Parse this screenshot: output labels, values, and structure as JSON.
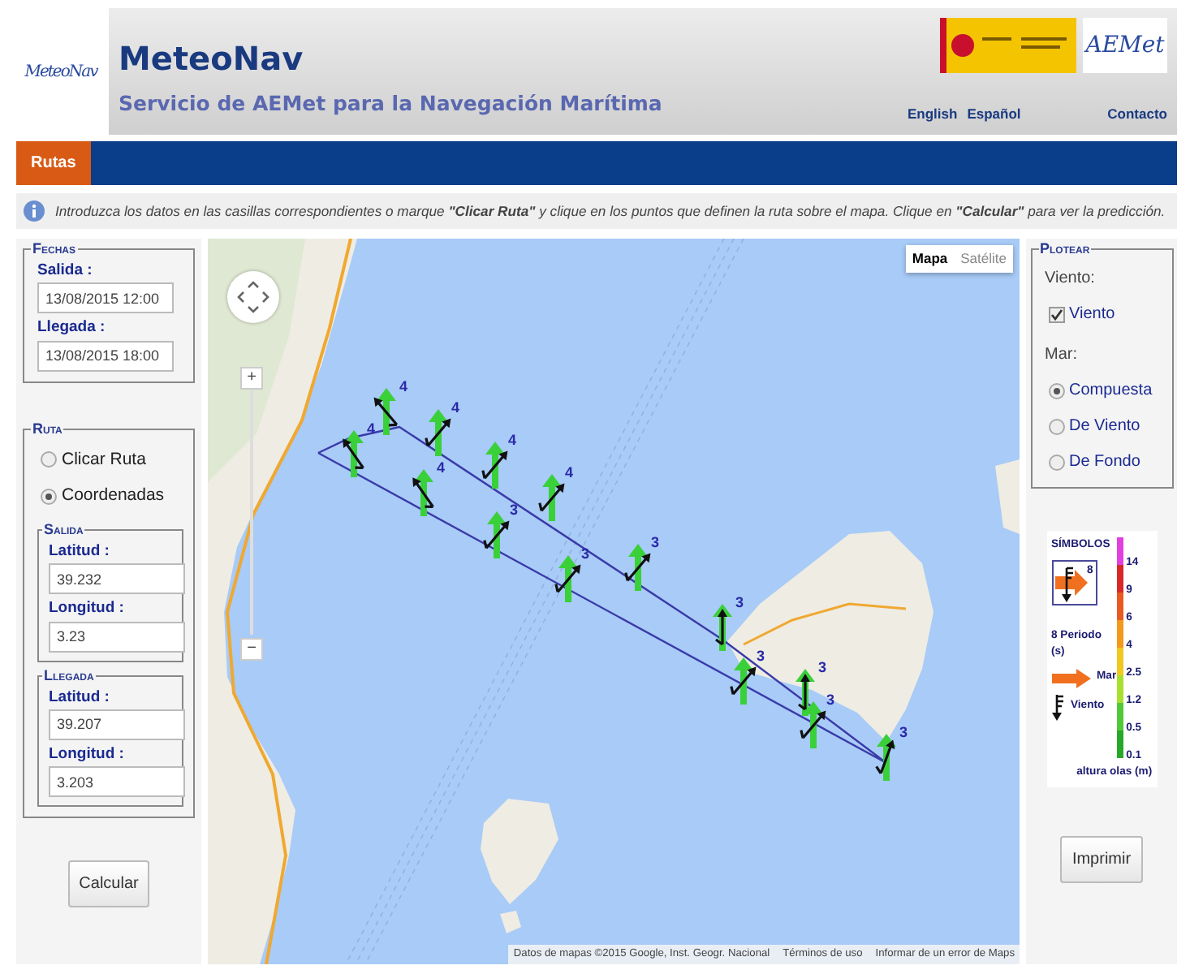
{
  "header": {
    "logo": "MeteoNav",
    "title": "MeteoNav",
    "subtitle": "Servicio de AEMet para la Navegación Marítima",
    "partner_logo": "AEMet",
    "links": [
      "English",
      "Español"
    ],
    "contact": "Contacto"
  },
  "tabs": [
    {
      "label": "Rutas",
      "selected": true
    }
  ],
  "info": "Introduzca los datos en las casillas correspondientes o marque **\"Clicar Ruta\"** y clique en los puntos que definen la ruta sobre el mapa. Clique en **\"Calcular\"** para ver la predicción.",
  "fechas": {
    "legend": "Fechas",
    "fields": [
      {
        "label": "Salida :",
        "value": "13/08/2015 12:00"
      },
      {
        "label": "Llegada :",
        "value": "13/08/2015 18:00"
      }
    ]
  },
  "ruta": {
    "legend": "Ruta",
    "options": [
      {
        "label": "Clicar Ruta",
        "selected": false
      },
      {
        "label": "Coordenadas",
        "selected": true
      }
    ],
    "groups": [
      {
        "legend": "Salida",
        "fields": [
          {
            "label": "Latitud :",
            "value": "39.232"
          },
          {
            "label": "Longitud :",
            "value": "3.23"
          }
        ]
      },
      {
        "legend": "Llegada",
        "fields": [
          {
            "label": "Latitud :",
            "value": "39.207"
          },
          {
            "label": "Longitud :",
            "value": "3.203"
          }
        ]
      }
    ]
  },
  "calcular_button": "Calcular",
  "map": {
    "type_buttons": [
      {
        "label": "Mapa",
        "selected": true
      },
      {
        "label": "Satélite",
        "selected": false
      }
    ],
    "zoom_in": "+",
    "zoom_out": "−",
    "markers": [
      {
        "label": "4"
      },
      {
        "label": "4"
      },
      {
        "label": "4"
      },
      {
        "label": "4"
      },
      {
        "label": "4"
      },
      {
        "label": "3"
      },
      {
        "label": "4"
      },
      {
        "label": "3"
      },
      {
        "label": "3"
      },
      {
        "label": "3"
      },
      {
        "label": "3"
      },
      {
        "label": "3"
      },
      {
        "label": "3"
      },
      {
        "label": "3"
      }
    ],
    "attribution": [
      "Datos de mapas ©2015 Google, Inst. Geogr. Nacional",
      "Términos de uso",
      "Informar de un error de Maps"
    ]
  },
  "plotear": {
    "legend": "Plotear",
    "wind_heading": "Viento:",
    "wind_options": [
      {
        "label": "Viento",
        "checked": true
      }
    ],
    "sea_heading": "Mar:",
    "sea_options": [
      {
        "label": "Compuesta",
        "selected": true
      },
      {
        "label": "De Viento",
        "selected": false
      },
      {
        "label": "De Fondo",
        "selected": false
      }
    ]
  },
  "symbols": {
    "title": "SÍMBOLOS",
    "sample_period": "8",
    "period_label": "8 Periodo (s)",
    "sea_label": "Mar",
    "wind_label": "Viento",
    "scale_title": "altura olas (m)",
    "scale": [
      {
        "label": "14",
        "color": "#e040e0"
      },
      {
        "label": "9",
        "color": "#d82828"
      },
      {
        "label": "6",
        "color": "#e85a20"
      },
      {
        "label": "4",
        "color": "#f39a1c"
      },
      {
        "label": "2.5",
        "color": "#f0c820"
      },
      {
        "label": "1.2",
        "color": "#a8e030"
      },
      {
        "label": "0.5",
        "color": "#50c838"
      },
      {
        "label": "0.1",
        "color": "#28a828"
      }
    ]
  },
  "print_button": "Imprimir"
}
